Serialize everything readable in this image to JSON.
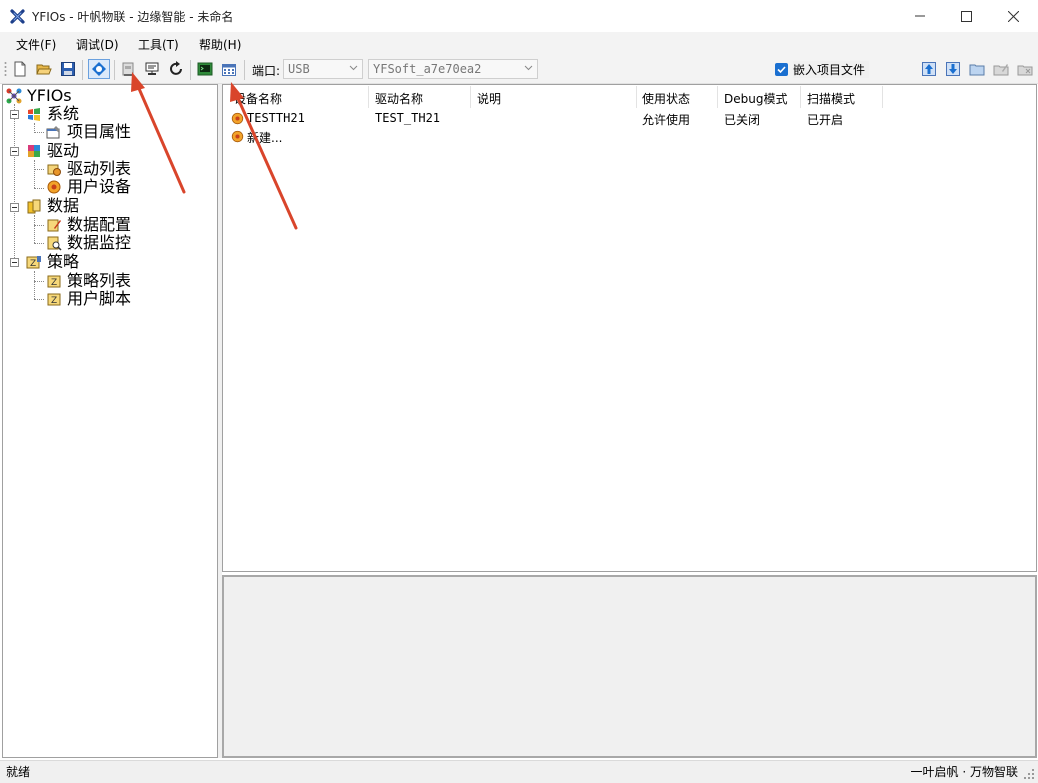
{
  "window": {
    "title": "YFIOs - 叶帆物联 - 边缘智能 - 未命名"
  },
  "menu": [
    "文件(F)",
    "调试(D)",
    "工具(T)",
    "帮助(H)"
  ],
  "toolbar": {
    "port_label": "端口:",
    "port_value": "USB",
    "device_value": "YFSoft_a7e70ea2",
    "embed_label": "嵌入项目文件",
    "embed_checked": true
  },
  "tree": {
    "root": "YFIOs",
    "system": "系统",
    "project_props": "项目属性",
    "driver": "驱动",
    "driver_list": "驱动列表",
    "user_devices": "用户设备",
    "data": "数据",
    "data_config": "数据配置",
    "data_monitor": "数据监控",
    "strategy": "策略",
    "strategy_list": "策略列表",
    "user_script": "用户脚本"
  },
  "list": {
    "columns": [
      "设备名称",
      "驱动名称",
      "说明",
      "使用状态",
      "Debug模式",
      "扫描模式"
    ],
    "rows": [
      {
        "name": "TESTTH21",
        "driver": "TEST_TH21",
        "desc": "",
        "status": "允许使用",
        "debug": "已关闭",
        "scan": "已开启"
      },
      {
        "name": "新建..."
      }
    ]
  },
  "status": {
    "left": "就绪",
    "right": "一叶启帆 · 万物智联"
  },
  "colors": {
    "accent": "#1a6fd0",
    "annotation_arrow": "#d9452b"
  }
}
